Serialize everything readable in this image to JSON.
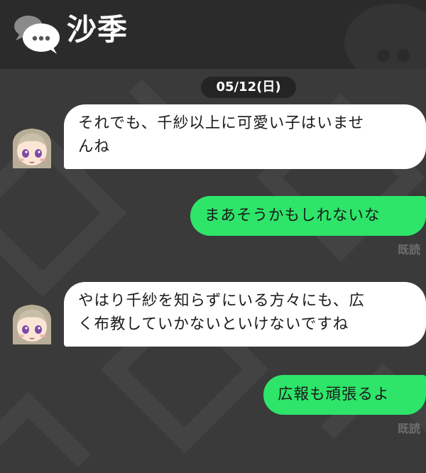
{
  "header": {
    "title": "沙季",
    "icon": "chat-bubble-icon"
  },
  "date_separator": "05/12(日)",
  "messages": [
    {
      "direction": "incoming",
      "lines": [
        "それでも、千紗以上に可愛い子はいませ",
        "んね"
      ],
      "avatar": "avatar-girl-icon"
    },
    {
      "direction": "outgoing",
      "lines": [
        "まあそうかもしれないな"
      ],
      "status": "既読"
    },
    {
      "direction": "incoming",
      "lines": [
        "やはり千紗を知らずにいる方々にも、広",
        "く布教していかないといけないですね"
      ],
      "avatar": "avatar-girl-icon"
    },
    {
      "direction": "outgoing",
      "lines": [
        "広報も頑張るよ"
      ],
      "status": "既読"
    }
  ],
  "colors": {
    "background": "#3a3a3a",
    "header": "#2b2b2b",
    "incoming_bubble": "#ffffff",
    "outgoing_bubble": "#2ee56a",
    "read_text": "#6e6e6e"
  }
}
